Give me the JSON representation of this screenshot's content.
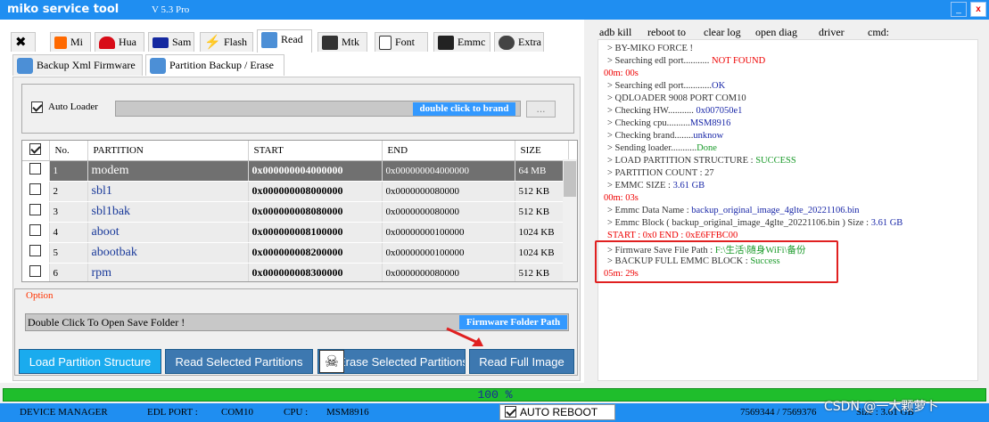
{
  "app": {
    "title": "miko service tool",
    "version": "V 5.3 Pro",
    "close_glyph": "x"
  },
  "tabs": [
    {
      "label": "",
      "icon": "wrench-icon"
    },
    {
      "label": "Mi",
      "icon": "mi-logo-icon"
    },
    {
      "label": "Hua",
      "icon": "huawei-logo-icon"
    },
    {
      "label": "Sam",
      "icon": "samsung-logo-icon"
    },
    {
      "label": "Flash",
      "icon": "flash-icon"
    },
    {
      "label": "Read",
      "icon": "read-icon"
    },
    {
      "label": "Mtk",
      "icon": "chip-icon"
    },
    {
      "label": "Font",
      "icon": "font-file-icon"
    },
    {
      "label": "Emmc",
      "icon": "emmc-icon"
    },
    {
      "label": "Extra",
      "icon": "extra-icon"
    }
  ],
  "subtabs": [
    "Backup Xml Firmware",
    "Partition Backup / Erase"
  ],
  "autoloader": {
    "label": "Auto Loader",
    "brand_button": "double click to brand",
    "dots": "...",
    "checked": true
  },
  "grid": {
    "columns": [
      "No.",
      "PARTITION",
      "START",
      "END",
      "SIZE"
    ],
    "rows": [
      {
        "no": "1",
        "name": "modem",
        "start": "0x000000004000000",
        "end": "0x000000004000000",
        "size": "64 MB"
      },
      {
        "no": "2",
        "name": "sbl1",
        "start": "0x000000008000000",
        "end": "0x0000000080000",
        "size": "512 KB"
      },
      {
        "no": "3",
        "name": "sbl1bak",
        "start": "0x000000008080000",
        "end": "0x0000000080000",
        "size": "512 KB"
      },
      {
        "no": "4",
        "name": "aboot",
        "start": "0x000000008100000",
        "end": "0x00000000100000",
        "size": "1024 KB"
      },
      {
        "no": "5",
        "name": "abootbak",
        "start": "0x000000008200000",
        "end": "0x00000000100000",
        "size": "1024 KB"
      },
      {
        "no": "6",
        "name": "rpm",
        "start": "0x000000008300000",
        "end": "0x0000000080000",
        "size": "512 KB"
      }
    ]
  },
  "option": {
    "label": "Option",
    "save_folder_text": "Double Click To Open Save Folder !",
    "fw_path_button": "Firmware Folder Path"
  },
  "actions": {
    "load": "Load Partition Structure",
    "read_selected": "Read Selected Partitions",
    "erase_selected": "Erase Selected Partitions",
    "read_full": "Read Full Image"
  },
  "right_toolbar": [
    "adb kill",
    "reboot to",
    "clear log",
    "open diag",
    "driver",
    "cmd:"
  ],
  "log": [
    {
      "parts": [
        {
          "t": "> BY-MIKO FORCE !",
          "c": ""
        }
      ]
    },
    {
      "parts": [
        {
          "t": "> Searching edl port........... ",
          "c": ""
        },
        {
          "t": "NOT FOUND",
          "c": "red"
        }
      ]
    },
    {
      "parts": [
        {
          "t": "00m: 00s",
          "c": "red"
        }
      ],
      "indent": false
    },
    {
      "parts": [
        {
          "t": "> Searching edl port............",
          "c": ""
        },
        {
          "t": "OK",
          "c": "blue"
        }
      ]
    },
    {
      "parts": [
        {
          "t": "> QDLOADER 9008 PORT COM10",
          "c": ""
        }
      ]
    },
    {
      "parts": [
        {
          "t": "> Checking HW........... ",
          "c": ""
        },
        {
          "t": "0x007050e1",
          "c": "blue"
        }
      ]
    },
    {
      "parts": [
        {
          "t": "> Checking cpu..........",
          "c": ""
        },
        {
          "t": "MSM8916",
          "c": "blue"
        }
      ]
    },
    {
      "parts": [
        {
          "t": "> Checking brand........",
          "c": ""
        },
        {
          "t": "unknow",
          "c": "blue"
        }
      ]
    },
    {
      "parts": [
        {
          "t": "> Sending loader...........",
          "c": ""
        },
        {
          "t": "Done",
          "c": "green"
        }
      ]
    },
    {
      "parts": [
        {
          "t": "> LOAD PARTITION  STRUCTURE  :  ",
          "c": ""
        },
        {
          "t": "SUCCESS",
          "c": "green"
        }
      ]
    },
    {
      "parts": [
        {
          "t": "> PARTITION COUNT  :  27",
          "c": ""
        }
      ]
    },
    {
      "parts": [
        {
          "t": "> EMMC SIZE   :  ",
          "c": ""
        },
        {
          "t": "3.61 GB",
          "c": "blue"
        }
      ]
    },
    {
      "parts": [
        {
          "t": "00m: 03s",
          "c": "red"
        }
      ],
      "indent": false
    },
    {
      "parts": [
        {
          "t": "> Emmc Data Name  :  ",
          "c": ""
        },
        {
          "t": "backup_original_image_4glte_20221106.bin",
          "c": "blue"
        }
      ]
    },
    {
      "parts": [
        {
          "t": "> Emmc Block ( backup_original_image_4glte_20221106.bin ) Size   :   ",
          "c": ""
        },
        {
          "t": "3.61 GB",
          "c": "blue"
        }
      ]
    },
    {
      "parts": [
        {
          "t": " START   :   0x0     END   :   0xE6FFBC00",
          "c": "pink"
        }
      ]
    },
    {
      "parts": [
        {
          "t": "> Firmware Save File  Path : ",
          "c": ""
        },
        {
          "t": "F:\\生活\\随身WiFi\\备份",
          "c": "green"
        }
      ]
    },
    {
      "parts": [
        {
          "t": "> BACKUP FULL EMMC BLOCK   :  ",
          "c": ""
        },
        {
          "t": "Success",
          "c": "green"
        }
      ]
    },
    {
      "parts": [
        {
          "t": "05m: 29s",
          "c": "red"
        }
      ],
      "indent": false
    }
  ],
  "progress": {
    "percent": 100,
    "label": "100 %"
  },
  "status": {
    "device_manager": "DEVICE MANAGER",
    "edl_port_label": "EDL PORT  :",
    "edl_port": "COM10",
    "cpu_label": "CPU  :",
    "cpu": "MSM8916",
    "auto_reboot": "AUTO REBOOT",
    "auto_reboot_checked": true,
    "block_progress": "7569344   /   7569376",
    "size_label": "Size  :  3.61 GB"
  },
  "watermark": "CSDN @一大颗萝卜"
}
